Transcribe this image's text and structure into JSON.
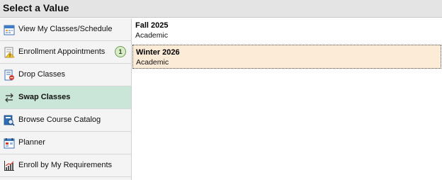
{
  "header": {
    "title": "Select a Value"
  },
  "sidebar": {
    "items": [
      {
        "label": "View My Classes/Schedule",
        "icon": "calendar-icon",
        "active": false
      },
      {
        "label": "Enrollment Appointments",
        "icon": "appointment-icon",
        "active": false,
        "badge": "1"
      },
      {
        "label": "Drop Classes",
        "icon": "drop-classes-icon",
        "active": false
      },
      {
        "label": "Swap Classes",
        "icon": "swap-arrows-icon",
        "active": true
      },
      {
        "label": "Browse Course Catalog",
        "icon": "catalog-search-icon",
        "active": false
      },
      {
        "label": "Planner",
        "icon": "planner-icon",
        "active": false
      },
      {
        "label": "Enroll by My Requirements",
        "icon": "requirements-chart-icon",
        "active": false
      }
    ]
  },
  "terms": [
    {
      "name": "Fall 2025",
      "type": "Academic",
      "selected": false
    },
    {
      "name": "Winter 2026",
      "type": "Academic",
      "selected": true
    }
  ],
  "colors": {
    "active_nav_bg": "#c9e6d8",
    "selected_term_bg": "#fcebd6",
    "header_bg": "#e4e4e4",
    "badge_bg": "#d8ecc9"
  }
}
